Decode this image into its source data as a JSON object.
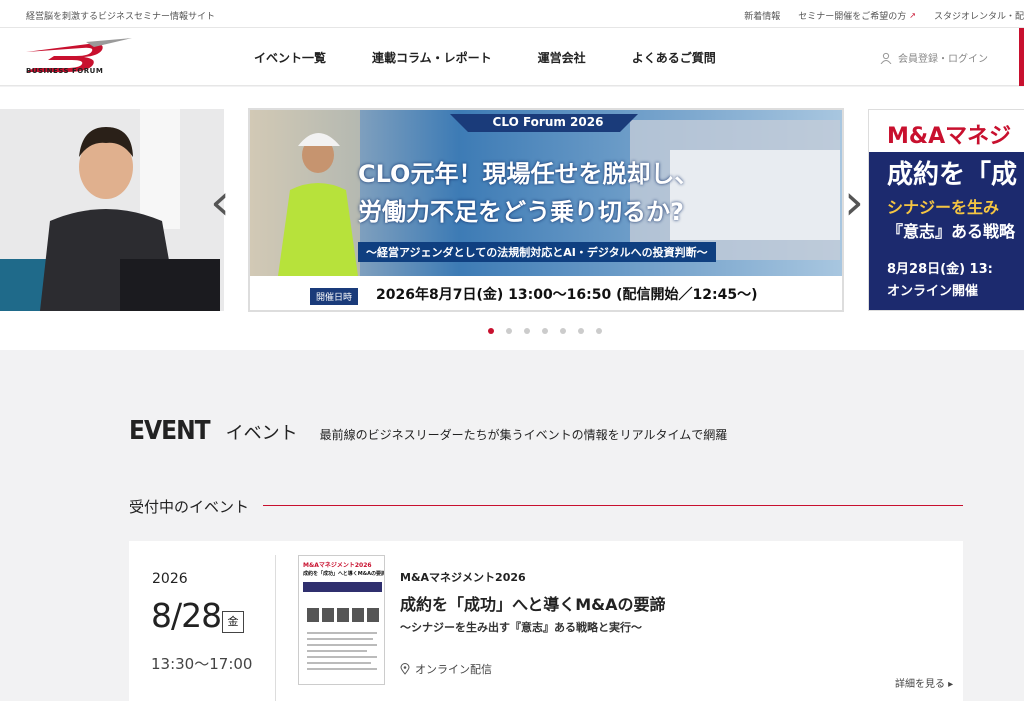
{
  "topbar": {
    "tagline": "経営脳を刺激するビジネスセミナー情報サイト",
    "links": [
      "新着情報",
      "セミナー開催をご希望の方",
      "スタジオレンタル・配"
    ]
  },
  "header": {
    "logo_text": "BUSINESS FORUM",
    "nav": [
      "イベント一覧",
      "連載コラム・レポート",
      "運営会社",
      "よくあるご質問"
    ],
    "login": "会員登録・ログイン"
  },
  "hero": {
    "main_slide": {
      "badge": "CLO Forum 2026",
      "headline1": "CLO元年！現場任せを脱却し、",
      "headline2": "労働力不足をどう乗り切るか?",
      "subline": "〜経営アジェンダとしての法規制対応とAI・デジタルへの投資判断〜",
      "date_label": "開催日時",
      "date_text": "2026年8月7日(金) 13:00〜16:50 (配信開始／12:45〜)"
    },
    "right_slide": {
      "l1": "M&Aマネジ",
      "l2": "成約を「成",
      "l3": "シナジーを生み",
      "l4": "『意志』ある戦略",
      "l5": "8月28日(金) 13:",
      "l6": "オンライン開催"
    },
    "dot_count": 7,
    "active_dot": 0
  },
  "section": {
    "en": "EVENT",
    "ja": "イベント",
    "desc": "最前線のビジネスリーダーたちが集うイベントの情報をリアルタイムで網羅",
    "sub": "受付中のイベント"
  },
  "card": {
    "year": "2026",
    "date": "8/28",
    "dow": "金",
    "time": "13:30〜17:00",
    "series": "M&Aマネジメント2026",
    "title": "成約を「成功」へと導くM&Aの要諦",
    "subtitle": "〜シナジーを生み出す『意志』ある戦略と実行〜",
    "place": "オンライン配信",
    "more": "詳細を見る"
  },
  "colors": {
    "accent": "#c8102e",
    "banner_blue": "#1c2a6e"
  }
}
